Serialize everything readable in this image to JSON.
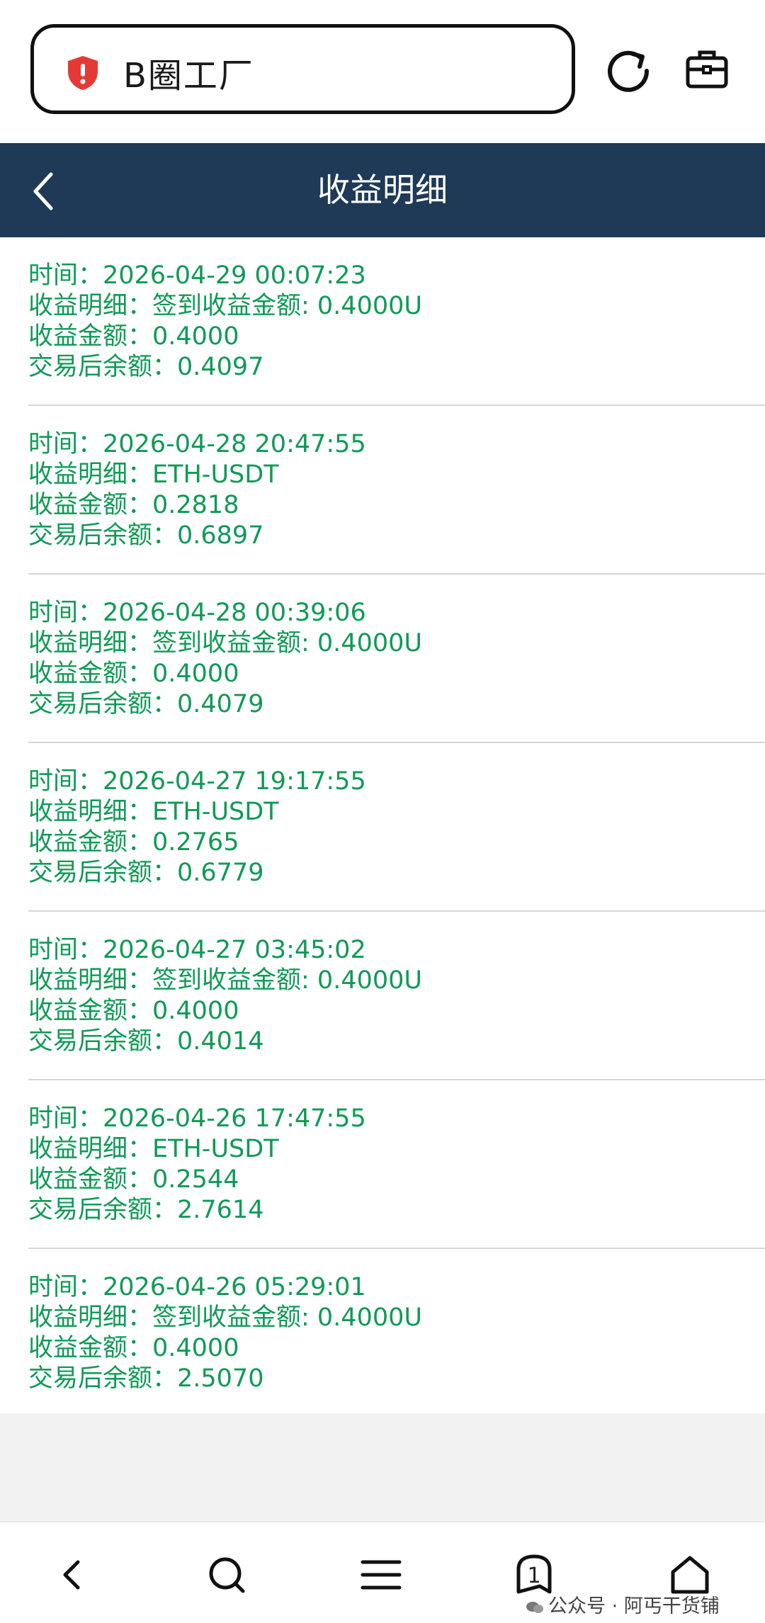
{
  "browser": {
    "url_title": "B圈工厂",
    "icons": [
      "shield-alert-icon",
      "refresh-icon",
      "toolbox-icon"
    ]
  },
  "header": {
    "title": "收益明细",
    "back_icon": "chevron-left-icon"
  },
  "records": [
    {
      "time": "时间：2026-04-29 00:07:23",
      "detail": "收益明细：签到收益金额: 0.4000U",
      "amount": "收益金额：0.4000",
      "balance": "交易后余额：0.4097"
    },
    {
      "time": "时间：2026-04-28 20:47:55",
      "detail": "收益明细：ETH-USDT",
      "amount": "收益金额：0.2818",
      "balance": "交易后余额：0.6897"
    },
    {
      "time": "时间：2026-04-28 00:39:06",
      "detail": "收益明细：签到收益金额: 0.4000U",
      "amount": "收益金额：0.4000",
      "balance": "交易后余额：0.4079"
    },
    {
      "time": "时间：2026-04-27 19:17:55",
      "detail": "收益明细：ETH-USDT",
      "amount": "收益金额：0.2765",
      "balance": "交易后余额：0.6779"
    },
    {
      "time": "时间：2026-04-27 03:45:02",
      "detail": "收益明细：签到收益金额: 0.4000U",
      "amount": "收益金额：0.4000",
      "balance": "交易后余额：0.4014"
    },
    {
      "time": "时间：2026-04-26 17:47:55",
      "detail": "收益明细：ETH-USDT",
      "amount": "收益金额：0.2544",
      "balance": "交易后余额：2.7614"
    },
    {
      "time": "时间：2026-04-26 05:29:01",
      "detail": "收益明细：签到收益金额: 0.4000U",
      "amount": "收益金额：0.4000",
      "balance": "交易后余额：2.5070"
    }
  ],
  "bottom_nav": {
    "tab_count": "1",
    "icons": [
      "back-icon",
      "search-icon",
      "menu-icon",
      "tabs-icon",
      "home-icon"
    ],
    "watermark": "公众号 · 阿丐干货铺"
  },
  "colors": {
    "header_bg": "#1e3a57",
    "record_text": "#0f9a56",
    "shield": "#e53935"
  }
}
